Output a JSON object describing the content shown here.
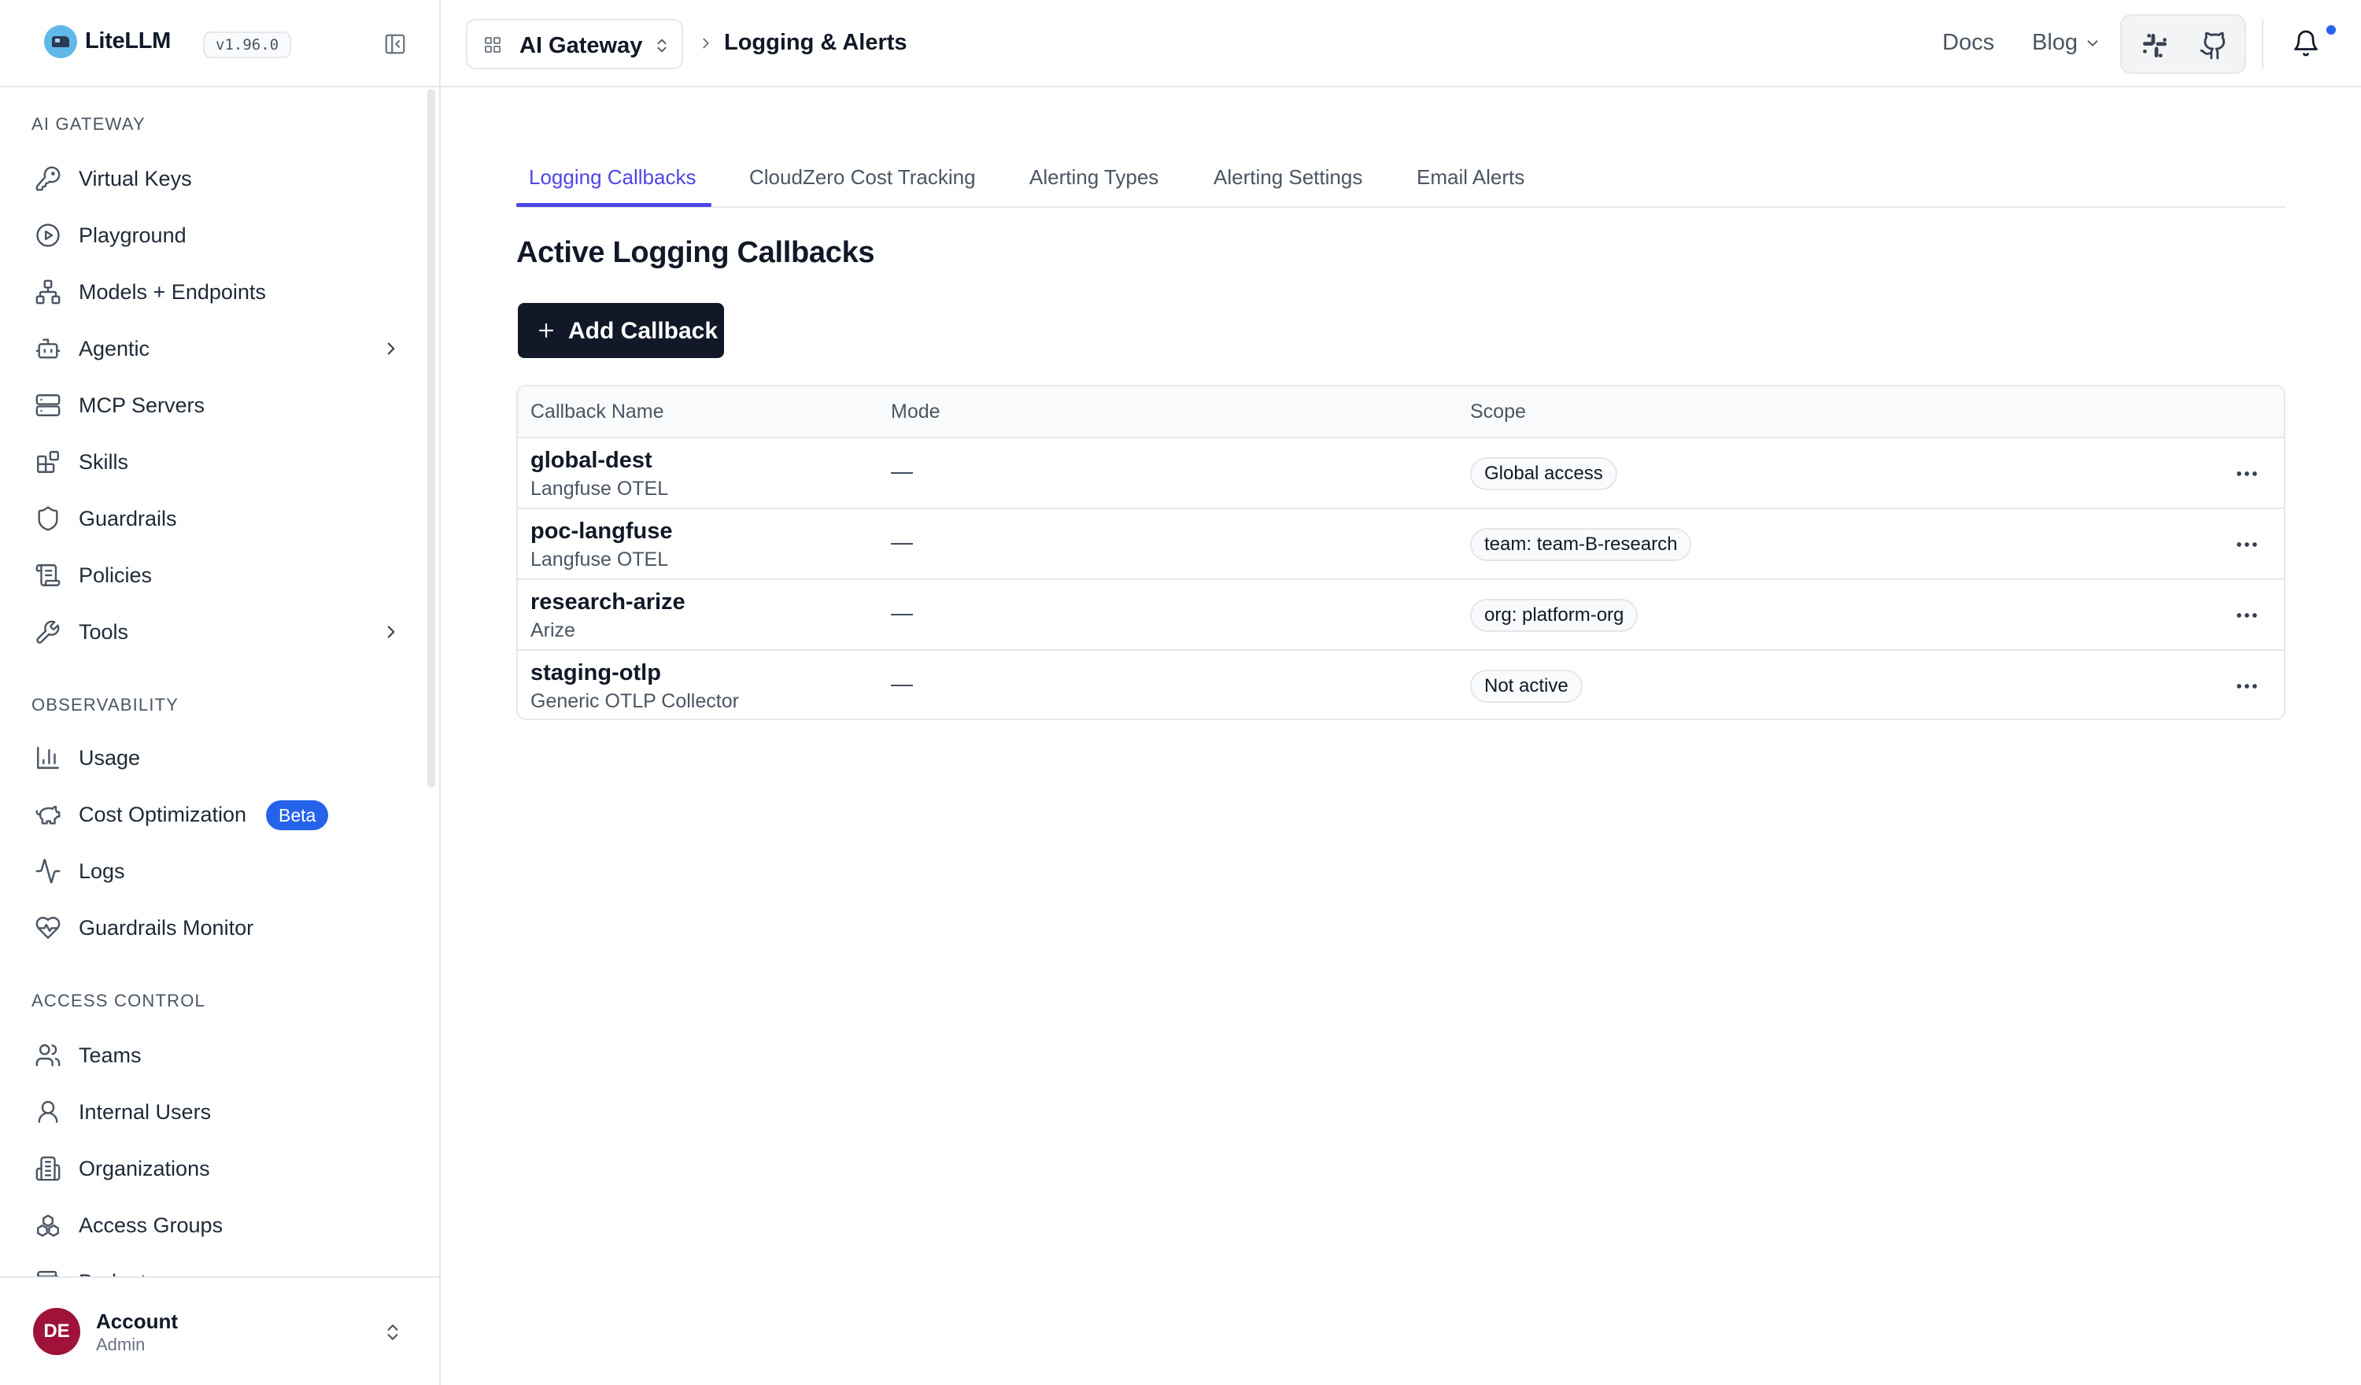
{
  "app": {
    "name": "LiteLLM",
    "version": "v1.96.0"
  },
  "sidebar": {
    "sections": [
      {
        "title": "AI GATEWAY"
      },
      {
        "title": "OBSERVABILITY"
      },
      {
        "title": "ACCESS CONTROL"
      }
    ],
    "gateway_items": [
      {
        "label": "Virtual Keys",
        "icon": "key-icon"
      },
      {
        "label": "Playground",
        "icon": "play-circle-icon"
      },
      {
        "label": "Models + Endpoints",
        "icon": "network-icon"
      },
      {
        "label": "Agentic",
        "icon": "robot-icon"
      },
      {
        "label": "MCP Servers",
        "icon": "server-icon"
      },
      {
        "label": "Skills",
        "icon": "blocks-icon"
      },
      {
        "label": "Guardrails",
        "icon": "shield-icon"
      },
      {
        "label": "Policies",
        "icon": "scroll-icon"
      },
      {
        "label": "Tools",
        "icon": "wrench-icon"
      }
    ],
    "observability_items": [
      {
        "label": "Usage",
        "icon": "bar-chart-icon"
      },
      {
        "label": "Cost Optimization",
        "icon": "piggy-bank-icon",
        "badge": "Beta"
      },
      {
        "label": "Logs",
        "icon": "activity-icon"
      },
      {
        "label": "Guardrails Monitor",
        "icon": "heart-pulse-icon"
      }
    ],
    "access_items": [
      {
        "label": "Teams",
        "icon": "users-icon"
      },
      {
        "label": "Internal Users",
        "icon": "user-icon"
      },
      {
        "label": "Organizations",
        "icon": "building-icon"
      },
      {
        "label": "Access Groups",
        "icon": "boxes-icon"
      },
      {
        "label": "Budgets",
        "icon": "wallet-icon"
      }
    ],
    "account": {
      "initials": "DE",
      "name": "Account",
      "role": "Admin"
    }
  },
  "topbar": {
    "gateway_label": "AI Gateway",
    "breadcrumb_current": "Logging & Alerts",
    "docs_label": "Docs",
    "blog_label": "Blog"
  },
  "tabs": [
    {
      "label": "Logging Callbacks",
      "active": true
    },
    {
      "label": "CloudZero Cost Tracking"
    },
    {
      "label": "Alerting Types"
    },
    {
      "label": "Alerting Settings"
    },
    {
      "label": "Email Alerts"
    }
  ],
  "main": {
    "heading": "Active Logging Callbacks",
    "add_button_label": "Add Callback",
    "table": {
      "columns": [
        "Callback Name",
        "Mode",
        "Scope"
      ],
      "rows": [
        {
          "name": "global-dest",
          "type": "Langfuse OTEL",
          "mode": "—",
          "scope": "Global access"
        },
        {
          "name": "poc-langfuse",
          "type": "Langfuse OTEL",
          "mode": "—",
          "scope": "team: team-B-research"
        },
        {
          "name": "research-arize",
          "type": "Arize",
          "mode": "—",
          "scope": "org: platform-org"
        },
        {
          "name": "staging-otlp",
          "type": "Generic OTLP Collector",
          "mode": "—",
          "scope": "Not active"
        }
      ]
    }
  },
  "colors": {
    "accent": "#4f46e5",
    "primary_button": "#111827",
    "beta_badge": "#2563eb",
    "avatar": "#9f1239"
  }
}
